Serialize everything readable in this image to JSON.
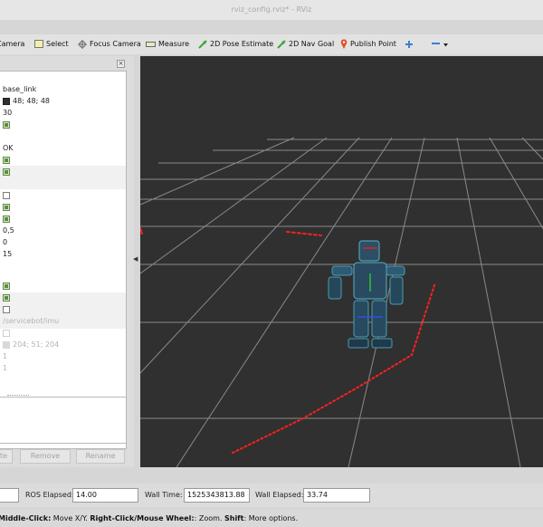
{
  "window": {
    "title": "rviz_config.rviz* - RViz"
  },
  "toolbar": {
    "camera": "Camera",
    "select": "Select",
    "focus_camera": "Focus Camera",
    "measure": "Measure",
    "pose_estimate": "2D Pose Estimate",
    "nav_goal": "2D Nav Goal",
    "publish_point": "Publish Point",
    "add_icon": "plus-icon",
    "remove_icon": "minus-dropdown-icon"
  },
  "displays": {
    "rows": [
      {
        "text": "base_link"
      },
      {
        "text": "48; 48; 48",
        "swatch": "#303030"
      },
      {
        "text": "30"
      },
      {
        "check": true
      },
      {
        "text": "OK"
      },
      {
        "check": true
      },
      {
        "check": true
      },
      {
        "check": false
      },
      {
        "check": true
      },
      {
        "check": true
      },
      {
        "text": "0,5"
      },
      {
        "text": "0"
      },
      {
        "text": "15"
      },
      {
        "check": true
      },
      {
        "check": true
      },
      {
        "check": false
      },
      {
        "text": "/servicebot/imu"
      },
      {
        "check": false
      },
      {
        "text": "204; 51; 204",
        "swatch": "#cc33cc"
      },
      {
        "text": "1"
      },
      {
        "text": "1"
      }
    ],
    "buttons": {
      "rename_partial": "te",
      "remove": "Remove",
      "rename": "Rename"
    }
  },
  "time": {
    "ros_elapsed_label": "ROS Elapsed:",
    "ros_elapsed": "14.00",
    "wall_time_label": "Wall Time:",
    "wall_time": "1525343813.88",
    "wall_elapsed_label": "Wall Elapsed:",
    "wall_elapsed": "33.74"
  },
  "status": {
    "middle_key": "Middle-Click:",
    "middle_desc": " Move X/Y. ",
    "right_key": "Right-Click/Mouse Wheel:",
    "right_desc": ": Zoom. ",
    "shift_key": "Shift",
    "shift_desc": ": More options."
  },
  "colors": {
    "viewport_bg": "#303030",
    "grid": "#a0a0a0",
    "laser": "#ff2020"
  }
}
